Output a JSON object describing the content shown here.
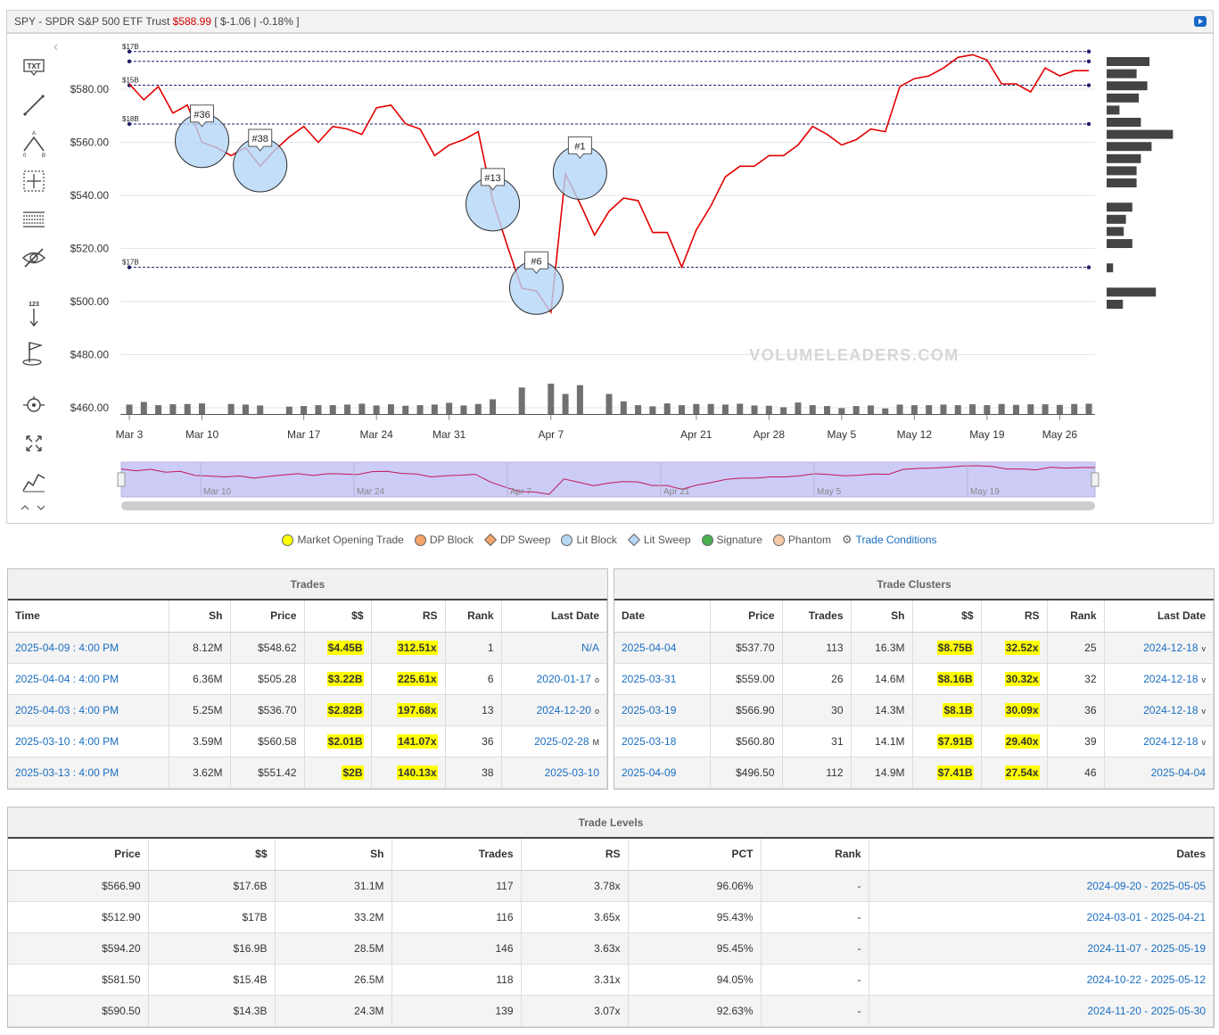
{
  "header": {
    "symbol": "SPY - SPDR S&P 500 ETF Trust",
    "price": "$588.99",
    "change": "[ $-1.06 | -0.18% ]"
  },
  "toolbar": {
    "tools": [
      "text-tool",
      "line-tool",
      "pattern-tool",
      "crosshair-tool",
      "fib-tool",
      "hide-tool",
      "sequence-tool",
      "flag-tool",
      "target-tool",
      "expand-tool",
      "chart-type-tool"
    ],
    "txt_label": "TXT",
    "seq_label": "123"
  },
  "chart_data": {
    "type": "line",
    "ylim": [
      455,
      595
    ],
    "y_ticks": [
      "$580.00",
      "$560.00",
      "$540.00",
      "$520.00",
      "$500.00",
      "$480.00",
      "$460.00"
    ],
    "y_tick_values": [
      580,
      560,
      540,
      520,
      500,
      480,
      460
    ],
    "x_ticks": [
      "Mar 3",
      "Mar 10",
      "Mar 17",
      "Mar 24",
      "Mar 31",
      "Apr 7",
      "Apr 21",
      "Apr 28",
      "May 5",
      "May 12",
      "May 19",
      "May 26"
    ],
    "x_tick_index": [
      0,
      5,
      12,
      17,
      22,
      29,
      39,
      44,
      49,
      54,
      59,
      64
    ],
    "navigator_labels": [
      "Mar 10",
      "Mar 24",
      "Apr 7",
      "Apr 21",
      "May 5",
      "May 19"
    ],
    "price": [
      582,
      576,
      581,
      571,
      574,
      560,
      558,
      555,
      558,
      551,
      557,
      562,
      566,
      560,
      566,
      565,
      563,
      573,
      574,
      567,
      565,
      555,
      559,
      561,
      564,
      538,
      521,
      505,
      504,
      496,
      548,
      537,
      525,
      534,
      539,
      538,
      526,
      526,
      513,
      527,
      536,
      547,
      551,
      551,
      555,
      555,
      559,
      566,
      563,
      559,
      561,
      565,
      564,
      581,
      584,
      585,
      588,
      592,
      593,
      591,
      582,
      582,
      579,
      588,
      585,
      587,
      587
    ],
    "volume": [
      3.2,
      4.1,
      3.0,
      3.3,
      3.4,
      3.6,
      0,
      3.4,
      3.2,
      2.9,
      0,
      2.5,
      2.7,
      3.0,
      3.0,
      3.2,
      3.5,
      2.9,
      3.3,
      2.8,
      3.0,
      3.2,
      3.8,
      2.9,
      3.4,
      5.0,
      0,
      9.0,
      0,
      10.3,
      6.8,
      9.8,
      0,
      6.8,
      4.3,
      3.0,
      2.6,
      3.6,
      3.0,
      3.4,
      3.4,
      3.2,
      3.5,
      2.9,
      2.8,
      2.3,
      3.9,
      3.0,
      2.7,
      2.0,
      2.7,
      2.9,
      1.9,
      3.2,
      3.0,
      3.0,
      3.2,
      3.0,
      3.3,
      3.0,
      3.4,
      3.1,
      3.3,
      3.3,
      3.1,
      3.4,
      3.5
    ],
    "levels": [
      {
        "label": "$17B",
        "price": 594.2
      },
      {
        "label": "",
        "price": 590.5
      },
      {
        "label": "$15B",
        "price": 581.5
      },
      {
        "label": "$18B",
        "price": 566.9
      },
      {
        "label": "$17B",
        "price": 512.9
      }
    ],
    "trade_markers": [
      {
        "label": "#36",
        "idx": 5,
        "price": 560.58
      },
      {
        "label": "#38",
        "idx": 9,
        "price": 551.42
      },
      {
        "label": "#13",
        "idx": 25,
        "price": 536.7
      },
      {
        "label": "#6",
        "idx": 28,
        "price": 505.28
      },
      {
        "label": "#1",
        "idx": 31,
        "price": 548.62
      }
    ],
    "volume_profile": [
      1.0,
      0.7,
      0.95,
      0.75,
      0.3,
      0.8,
      1.55,
      1.05,
      0.8,
      0.7,
      0.7,
      0,
      0.6,
      0.45,
      0.4,
      0.6,
      0,
      0.15,
      0,
      1.15,
      0.38
    ],
    "watermark": "VOLUMELEADERS.COM"
  },
  "legend": [
    {
      "label": "Market Opening Trade",
      "shape": "dot",
      "color": "#ffff00"
    },
    {
      "label": "DP Block",
      "shape": "dot",
      "color": "#f5a46a"
    },
    {
      "label": "DP Sweep",
      "shape": "dia",
      "color": "#f5a46a"
    },
    {
      "label": "Lit Block",
      "shape": "dot",
      "color": "#b8d7f5"
    },
    {
      "label": "Lit Sweep",
      "shape": "dia",
      "color": "#b8d7f5"
    },
    {
      "label": "Signature",
      "shape": "dot",
      "color": "#4caf50"
    },
    {
      "label": "Phantom",
      "shape": "dot",
      "color": "#f6c9a8"
    },
    {
      "label": "Trade Conditions",
      "shape": "gear",
      "color": "#888"
    }
  ],
  "trades": {
    "title": "Trades",
    "columns": [
      "Time",
      "Sh",
      "Price",
      "$$",
      "RS",
      "Rank",
      "Last Date"
    ],
    "rows": [
      {
        "time": "2025-04-09 : 4:00 PM",
        "sh": "8.12M",
        "price": "$548.62",
        "dollars": "$4.45B",
        "rs": "312.51x",
        "rank": "1",
        "last": "N/A",
        "sfx": ""
      },
      {
        "time": "2025-04-04 : 4:00 PM",
        "sh": "6.36M",
        "price": "$505.28",
        "dollars": "$3.22B",
        "rs": "225.61x",
        "rank": "6",
        "last": "2020-01-17",
        "sfx": "o"
      },
      {
        "time": "2025-04-03 : 4:00 PM",
        "sh": "5.25M",
        "price": "$536.70",
        "dollars": "$2.82B",
        "rs": "197.68x",
        "rank": "13",
        "last": "2024-12-20",
        "sfx": "o"
      },
      {
        "time": "2025-03-10 : 4:00 PM",
        "sh": "3.59M",
        "price": "$560.58",
        "dollars": "$2.01B",
        "rs": "141.07x",
        "rank": "36",
        "last": "2025-02-28",
        "sfx": "M"
      },
      {
        "time": "2025-03-13 : 4:00 PM",
        "sh": "3.62M",
        "price": "$551.42",
        "dollars": "$2B",
        "rs": "140.13x",
        "rank": "38",
        "last": "2025-03-10",
        "sfx": ""
      }
    ]
  },
  "clusters": {
    "title": "Trade Clusters",
    "columns": [
      "Date",
      "Price",
      "Trades",
      "Sh",
      "$$",
      "RS",
      "Rank",
      "Last Date"
    ],
    "rows": [
      {
        "date": "2025-04-04",
        "price": "$537.70",
        "trades": "113",
        "sh": "16.3M",
        "dollars": "$8.75B",
        "rs": "32.52x",
        "rank": "25",
        "last": "2024-12-18",
        "sfx": "v"
      },
      {
        "date": "2025-03-31",
        "price": "$559.00",
        "trades": "26",
        "sh": "14.6M",
        "dollars": "$8.16B",
        "rs": "30.32x",
        "rank": "32",
        "last": "2024-12-18",
        "sfx": "v"
      },
      {
        "date": "2025-03-19",
        "price": "$566.90",
        "trades": "30",
        "sh": "14.3M",
        "dollars": "$8.1B",
        "rs": "30.09x",
        "rank": "36",
        "last": "2024-12-18",
        "sfx": "v"
      },
      {
        "date": "2025-03-18",
        "price": "$560.80",
        "trades": "31",
        "sh": "14.1M",
        "dollars": "$7.91B",
        "rs": "29.40x",
        "rank": "39",
        "last": "2024-12-18",
        "sfx": "v"
      },
      {
        "date": "2025-04-09",
        "price": "$496.50",
        "trades": "112",
        "sh": "14.9M",
        "dollars": "$7.41B",
        "rs": "27.54x",
        "rank": "46",
        "last": "2025-04-04",
        "sfx": ""
      }
    ]
  },
  "levels": {
    "title": "Trade Levels",
    "columns": [
      "Price",
      "$$",
      "Sh",
      "Trades",
      "RS",
      "PCT",
      "Rank",
      "Dates"
    ],
    "rows": [
      {
        "price": "$566.90",
        "dollars": "$17.6B",
        "sh": "31.1M",
        "trades": "117",
        "rs": "3.78x",
        "pct": "96.06%",
        "rank": "-",
        "dates": "2024-09-20 - 2025-05-05"
      },
      {
        "price": "$512.90",
        "dollars": "$17B",
        "sh": "33.2M",
        "trades": "116",
        "rs": "3.65x",
        "pct": "95.43%",
        "rank": "-",
        "dates": "2024-03-01 - 2025-04-21"
      },
      {
        "price": "$594.20",
        "dollars": "$16.9B",
        "sh": "28.5M",
        "trades": "146",
        "rs": "3.63x",
        "pct": "95.45%",
        "rank": "-",
        "dates": "2024-11-07 - 2025-05-19"
      },
      {
        "price": "$581.50",
        "dollars": "$15.4B",
        "sh": "26.5M",
        "trades": "118",
        "rs": "3.31x",
        "pct": "94.05%",
        "rank": "-",
        "dates": "2024-10-22 - 2025-05-12"
      },
      {
        "price": "$590.50",
        "dollars": "$14.3B",
        "sh": "24.3M",
        "trades": "139",
        "rs": "3.07x",
        "pct": "92.63%",
        "rank": "-",
        "dates": "2024-11-20 - 2025-05-30"
      }
    ]
  }
}
